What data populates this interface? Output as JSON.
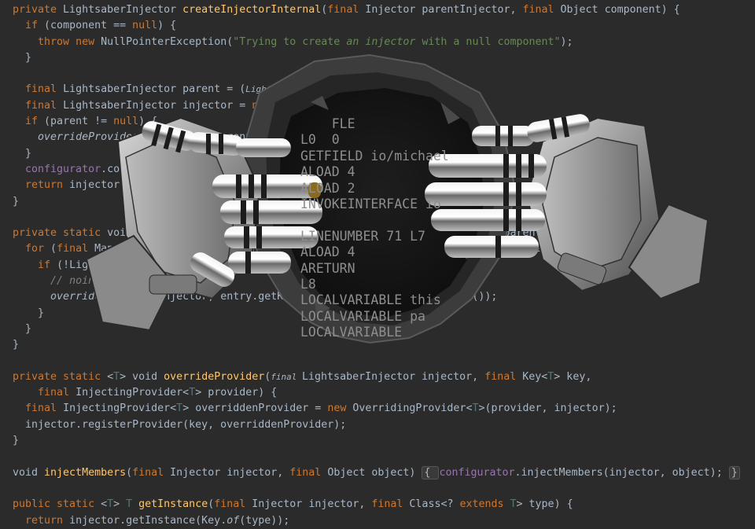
{
  "editor": {
    "lines": [
      [
        {
          "t": "private ",
          "c": "kw"
        },
        {
          "t": "LightsaberInjector "
        },
        {
          "t": "createInjectorInternal",
          "c": "fn"
        },
        {
          "t": "("
        },
        {
          "t": "final ",
          "c": "kw"
        },
        {
          "t": "Injector parentInjector, "
        },
        {
          "t": "final ",
          "c": "kw"
        },
        {
          "t": "Object component) {"
        }
      ],
      [
        {
          "t": "  "
        },
        {
          "t": "if ",
          "c": "kw"
        },
        {
          "t": "(component == "
        },
        {
          "t": "null",
          "c": "kw"
        },
        {
          "t": ") {"
        }
      ],
      [
        {
          "t": "    "
        },
        {
          "t": "throw new ",
          "c": "kw"
        },
        {
          "t": "NullPointerException("
        },
        {
          "t": "\"Trying to create ",
          "c": "str"
        },
        {
          "t": "an injector",
          "c": "str it"
        },
        {
          "t": " with a null component\"",
          "c": "str"
        },
        {
          "t": ");"
        }
      ],
      [
        {
          "t": "  }"
        }
      ],
      [
        {
          "t": ""
        }
      ],
      [
        {
          "t": "  "
        },
        {
          "t": "final ",
          "c": "kw"
        },
        {
          "t": "LightsaberInjector parent = ("
        },
        {
          "t": "LightsaberInjector",
          "c": "ann"
        },
        {
          "t": ") parentInjector;"
        }
      ],
      [
        {
          "t": "  "
        },
        {
          "t": "final ",
          "c": "kw"
        },
        {
          "t": "LightsaberInjector injector = "
        },
        {
          "t": "new ",
          "c": "kw"
        },
        {
          "t": "LightsaberInjector(parent);"
        }
      ],
      [
        {
          "t": "  "
        },
        {
          "t": "if ",
          "c": "kw"
        },
        {
          "t": "(parent != "
        },
        {
          "t": "null",
          "c": "kw"
        },
        {
          "t": ") {"
        }
      ],
      [
        {
          "t": "    "
        },
        {
          "t": "overrideProviders",
          "c": "it"
        },
        {
          "t": "(injector, parent);"
        }
      ],
      [
        {
          "t": "  }"
        }
      ],
      [
        {
          "t": "  "
        },
        {
          "t": "configurator",
          "c": "fld"
        },
        {
          "t": ".configureInjector(injector, component);"
        }
      ],
      [
        {
          "t": "  "
        },
        {
          "t": "return ",
          "c": "kw"
        },
        {
          "t": "injector;"
        }
      ],
      [
        {
          "t": "}"
        }
      ],
      [
        {
          "t": ""
        }
      ],
      [
        {
          "t": "private static ",
          "c": "kw"
        },
        {
          "t": "void "
        },
        {
          "t": "overrideProviders",
          "c": "fn"
        },
        {
          "t": "(final Injector injector, final Injector parent) {"
        }
      ],
      [
        {
          "t": "  "
        },
        {
          "t": "for ",
          "c": "kw"
        },
        {
          "t": "("
        },
        {
          "t": "final ",
          "c": "kw"
        },
        {
          "t": "Map.Entry<Object, InjectingProvider<?>> entry : parent.getProviders().entrySet()) {"
        }
      ],
      [
        {
          "t": "    "
        },
        {
          "t": "if ",
          "c": "kw"
        },
        {
          "t": "(!LightsaberInjector.isOverridden(entry)) {"
        }
      ],
      [
        {
          "t": "      "
        },
        {
          "t": "// noinspection unchecked",
          "c": "cm"
        }
      ],
      [
        {
          "t": "      "
        },
        {
          "t": "overrideProvider",
          "c": "it"
        },
        {
          "t": "(injector, entry.getKey(), injector, entry.getValue());"
        }
      ],
      [
        {
          "t": "    }"
        }
      ],
      [
        {
          "t": "  }"
        }
      ],
      [
        {
          "t": "}"
        }
      ],
      [
        {
          "t": ""
        }
      ],
      [
        {
          "t": "private static ",
          "c": "kw"
        },
        {
          "t": "<"
        },
        {
          "t": "T",
          "c": "gen"
        },
        {
          "t": "> "
        },
        {
          "t": "void "
        },
        {
          "t": "overrideProvider",
          "c": "fn"
        },
        {
          "t": "("
        },
        {
          "t": "final ",
          "c": "ann"
        },
        {
          "t": "LightsaberInjector injector, "
        },
        {
          "t": "final ",
          "c": "kw"
        },
        {
          "t": "Key<"
        },
        {
          "t": "T",
          "c": "gen"
        },
        {
          "t": "> key,"
        }
      ],
      [
        {
          "t": "    "
        },
        {
          "t": "final ",
          "c": "kw"
        },
        {
          "t": "InjectingProvider<"
        },
        {
          "t": "T",
          "c": "gen"
        },
        {
          "t": "> provider) {"
        }
      ],
      [
        {
          "t": "  "
        },
        {
          "t": "final ",
          "c": "kw"
        },
        {
          "t": "InjectingProvider<"
        },
        {
          "t": "T",
          "c": "gen"
        },
        {
          "t": "> overriddenProvider = "
        },
        {
          "t": "new ",
          "c": "kw"
        },
        {
          "t": "OverridingProvider<"
        },
        {
          "t": "T",
          "c": "gen"
        },
        {
          "t": ">(provider, injector);"
        }
      ],
      [
        {
          "t": "  injector.registerProvider(key, overriddenProvider);"
        }
      ],
      [
        {
          "t": "}"
        }
      ],
      [
        {
          "t": ""
        }
      ],
      [
        {
          "t": "void "
        },
        {
          "t": "injectMembers",
          "c": "fn"
        },
        {
          "t": "("
        },
        {
          "t": "final ",
          "c": "kw"
        },
        {
          "t": "Injector injector, "
        },
        {
          "t": "final ",
          "c": "kw"
        },
        {
          "t": "Object object) "
        },
        {
          "t": "{ ",
          "c": "fold"
        },
        {
          "t": "configurator",
          "c": "fld"
        },
        {
          "t": ".injectMembers(injector, object); "
        },
        {
          "t": "}",
          "c": "fold"
        }
      ],
      [
        {
          "t": ""
        }
      ],
      [
        {
          "t": "public static ",
          "c": "kw"
        },
        {
          "t": "<"
        },
        {
          "t": "T",
          "c": "gen"
        },
        {
          "t": "> "
        },
        {
          "t": "T ",
          "c": "gen"
        },
        {
          "t": "getInstance",
          "c": "fn"
        },
        {
          "t": "("
        },
        {
          "t": "final ",
          "c": "kw"
        },
        {
          "t": "Injector injector, "
        },
        {
          "t": "final ",
          "c": "kw"
        },
        {
          "t": "Class<? "
        },
        {
          "t": "extends ",
          "c": "kw"
        },
        {
          "t": "T",
          "c": "gen"
        },
        {
          "t": "> type) {"
        }
      ],
      [
        {
          "t": "  "
        },
        {
          "t": "return ",
          "c": "kw"
        },
        {
          "t": "injector.getInstance(Key."
        },
        {
          "t": "of",
          "c": "it"
        },
        {
          "t": "(type));"
        }
      ]
    ]
  },
  "bytecode": {
    "lines": [
      "    FLE",
      "L0  0",
      "GETFIELD io/michael",
      "ALOAD 4",
      "ALOAD 2",
      "INVOKEINTERFACE io",
      "",
      "LINENUMBER 71 L7",
      "ALOAD 4",
      "ARETURN",
      "L8",
      "LOCALVARIABLE this",
      "LOCALVARIABLE pa",
      "LOCALVARIABLE"
    ]
  },
  "colors": {
    "background": "#2b2b2b",
    "keyword": "#cc7832",
    "method": "#ffc66d",
    "string": "#6a8759",
    "field": "#9876aa",
    "comment": "#808080",
    "generic": "#507874",
    "text": "#a9b7c6"
  }
}
